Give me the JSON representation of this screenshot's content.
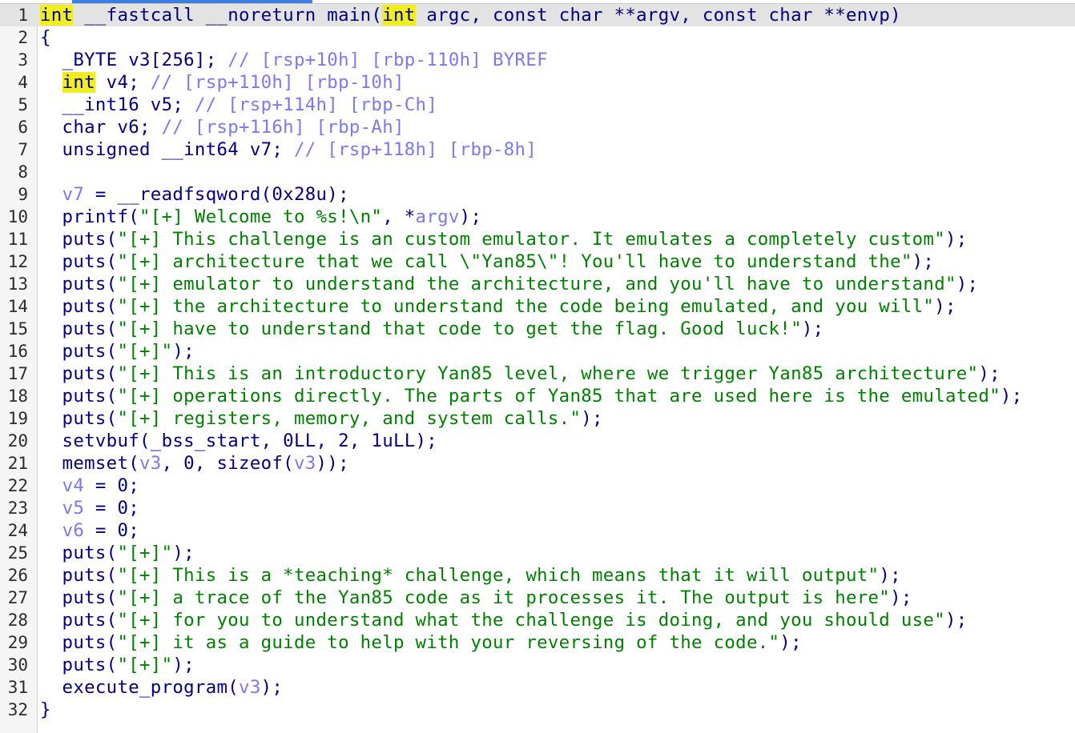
{
  "lines": [
    {
      "n": "1",
      "parts": [
        {
          "t": "int",
          "c": "hl"
        },
        {
          "t": " __fastcall __noreturn main(",
          "c": "blk"
        },
        {
          "t": "int",
          "c": "hl"
        },
        {
          "t": " argc, const char **argv, const char **envp)",
          "c": "blk"
        }
      ]
    },
    {
      "n": "2",
      "parts": [
        {
          "t": "{",
          "c": "blk"
        }
      ]
    },
    {
      "n": "3",
      "parts": [
        {
          "t": "  _BYTE v3[256]; ",
          "c": "blk"
        },
        {
          "t": "// [rsp+10h] [rbp-110h] BYREF",
          "c": "com"
        }
      ]
    },
    {
      "n": "4",
      "parts": [
        {
          "t": "  ",
          "c": "blk"
        },
        {
          "t": "int",
          "c": "hl"
        },
        {
          "t": " v4; ",
          "c": "blk"
        },
        {
          "t": "// [rsp+110h] [rbp-10h]",
          "c": "com"
        }
      ]
    },
    {
      "n": "5",
      "parts": [
        {
          "t": "  __int16 v5; ",
          "c": "blk"
        },
        {
          "t": "// [rsp+114h] [rbp-Ch]",
          "c": "com"
        }
      ]
    },
    {
      "n": "6",
      "parts": [
        {
          "t": "  char v6; ",
          "c": "blk"
        },
        {
          "t": "// [rsp+116h] [rbp-Ah]",
          "c": "com"
        }
      ]
    },
    {
      "n": "7",
      "parts": [
        {
          "t": "  unsigned __int64 v7; ",
          "c": "blk"
        },
        {
          "t": "// [rsp+118h] [rbp-8h]",
          "c": "com"
        }
      ]
    },
    {
      "n": "8",
      "parts": [
        {
          "t": "",
          "c": "blk"
        }
      ]
    },
    {
      "n": "9",
      "parts": [
        {
          "t": "  ",
          "c": "blk"
        },
        {
          "t": "v7",
          "c": "var"
        },
        {
          "t": " = __readfsqword(0x28u);",
          "c": "blk"
        }
      ]
    },
    {
      "n": "10",
      "parts": [
        {
          "t": "  printf(",
          "c": "blk"
        },
        {
          "t": "\"[+] Welcome to %s!\\n\"",
          "c": "str"
        },
        {
          "t": ", *",
          "c": "blk"
        },
        {
          "t": "argv",
          "c": "var"
        },
        {
          "t": ");",
          "c": "blk"
        }
      ]
    },
    {
      "n": "11",
      "parts": [
        {
          "t": "  puts(",
          "c": "blk"
        },
        {
          "t": "\"[+] This challenge is an custom emulator. It emulates a completely custom\"",
          "c": "str"
        },
        {
          "t": ");",
          "c": "blk"
        }
      ]
    },
    {
      "n": "12",
      "parts": [
        {
          "t": "  puts(",
          "c": "blk"
        },
        {
          "t": "\"[+] architecture that we call \\\"Yan85\\\"! You'll have to understand the\"",
          "c": "str"
        },
        {
          "t": ");",
          "c": "blk"
        }
      ]
    },
    {
      "n": "13",
      "parts": [
        {
          "t": "  puts(",
          "c": "blk"
        },
        {
          "t": "\"[+] emulator to understand the architecture, and you'll have to understand\"",
          "c": "str"
        },
        {
          "t": ");",
          "c": "blk"
        }
      ]
    },
    {
      "n": "14",
      "parts": [
        {
          "t": "  puts(",
          "c": "blk"
        },
        {
          "t": "\"[+] the architecture to understand the code being emulated, and you will\"",
          "c": "str"
        },
        {
          "t": ");",
          "c": "blk"
        }
      ]
    },
    {
      "n": "15",
      "parts": [
        {
          "t": "  puts(",
          "c": "blk"
        },
        {
          "t": "\"[+] have to understand that code to get the flag. Good luck!\"",
          "c": "str"
        },
        {
          "t": ");",
          "c": "blk"
        }
      ]
    },
    {
      "n": "16",
      "parts": [
        {
          "t": "  puts(",
          "c": "blk"
        },
        {
          "t": "\"[+]\"",
          "c": "str"
        },
        {
          "t": ");",
          "c": "blk"
        }
      ]
    },
    {
      "n": "17",
      "parts": [
        {
          "t": "  puts(",
          "c": "blk"
        },
        {
          "t": "\"[+] This is an introductory Yan85 level, where we trigger Yan85 architecture\"",
          "c": "str"
        },
        {
          "t": ");",
          "c": "blk"
        }
      ]
    },
    {
      "n": "18",
      "parts": [
        {
          "t": "  puts(",
          "c": "blk"
        },
        {
          "t": "\"[+] operations directly. The parts of Yan85 that are used here is the emulated\"",
          "c": "str"
        },
        {
          "t": ");",
          "c": "blk"
        }
      ]
    },
    {
      "n": "19",
      "parts": [
        {
          "t": "  puts(",
          "c": "blk"
        },
        {
          "t": "\"[+] registers, memory, and system calls.\"",
          "c": "str"
        },
        {
          "t": ");",
          "c": "blk"
        }
      ]
    },
    {
      "n": "20",
      "parts": [
        {
          "t": "  setvbuf(_bss_start, 0LL, 2, 1uLL);",
          "c": "blk"
        }
      ]
    },
    {
      "n": "21",
      "parts": [
        {
          "t": "  memset(",
          "c": "blk"
        },
        {
          "t": "v3",
          "c": "var"
        },
        {
          "t": ", 0, sizeof(",
          "c": "blk"
        },
        {
          "t": "v3",
          "c": "var"
        },
        {
          "t": "));",
          "c": "blk"
        }
      ]
    },
    {
      "n": "22",
      "parts": [
        {
          "t": "  ",
          "c": "blk"
        },
        {
          "t": "v4",
          "c": "var"
        },
        {
          "t": " = 0;",
          "c": "blk"
        }
      ]
    },
    {
      "n": "23",
      "parts": [
        {
          "t": "  ",
          "c": "blk"
        },
        {
          "t": "v5",
          "c": "var"
        },
        {
          "t": " = 0;",
          "c": "blk"
        }
      ]
    },
    {
      "n": "24",
      "parts": [
        {
          "t": "  ",
          "c": "blk"
        },
        {
          "t": "v6",
          "c": "var"
        },
        {
          "t": " = 0;",
          "c": "blk"
        }
      ]
    },
    {
      "n": "25",
      "parts": [
        {
          "t": "  puts(",
          "c": "blk"
        },
        {
          "t": "\"[+]\"",
          "c": "str"
        },
        {
          "t": ");",
          "c": "blk"
        }
      ]
    },
    {
      "n": "26",
      "parts": [
        {
          "t": "  puts(",
          "c": "blk"
        },
        {
          "t": "\"[+] This is a *teaching* challenge, which means that it will output\"",
          "c": "str"
        },
        {
          "t": ");",
          "c": "blk"
        }
      ]
    },
    {
      "n": "27",
      "parts": [
        {
          "t": "  puts(",
          "c": "blk"
        },
        {
          "t": "\"[+] a trace of the Yan85 code as it processes it. The output is here\"",
          "c": "str"
        },
        {
          "t": ");",
          "c": "blk"
        }
      ]
    },
    {
      "n": "28",
      "parts": [
        {
          "t": "  puts(",
          "c": "blk"
        },
        {
          "t": "\"[+] for you to understand what the challenge is doing, and you should use\"",
          "c": "str"
        },
        {
          "t": ");",
          "c": "blk"
        }
      ]
    },
    {
      "n": "29",
      "parts": [
        {
          "t": "  puts(",
          "c": "blk"
        },
        {
          "t": "\"[+] it as a guide to help with your reversing of the code.\"",
          "c": "str"
        },
        {
          "t": ");",
          "c": "blk"
        }
      ]
    },
    {
      "n": "30",
      "parts": [
        {
          "t": "  puts(",
          "c": "blk"
        },
        {
          "t": "\"[+]\"",
          "c": "str"
        },
        {
          "t": ");",
          "c": "blk"
        }
      ]
    },
    {
      "n": "31",
      "parts": [
        {
          "t": "  execute_program(",
          "c": "blk"
        },
        {
          "t": "v3",
          "c": "var"
        },
        {
          "t": ");",
          "c": "blk"
        }
      ]
    },
    {
      "n": "32",
      "parts": [
        {
          "t": "}",
          "c": "blk"
        }
      ]
    }
  ]
}
